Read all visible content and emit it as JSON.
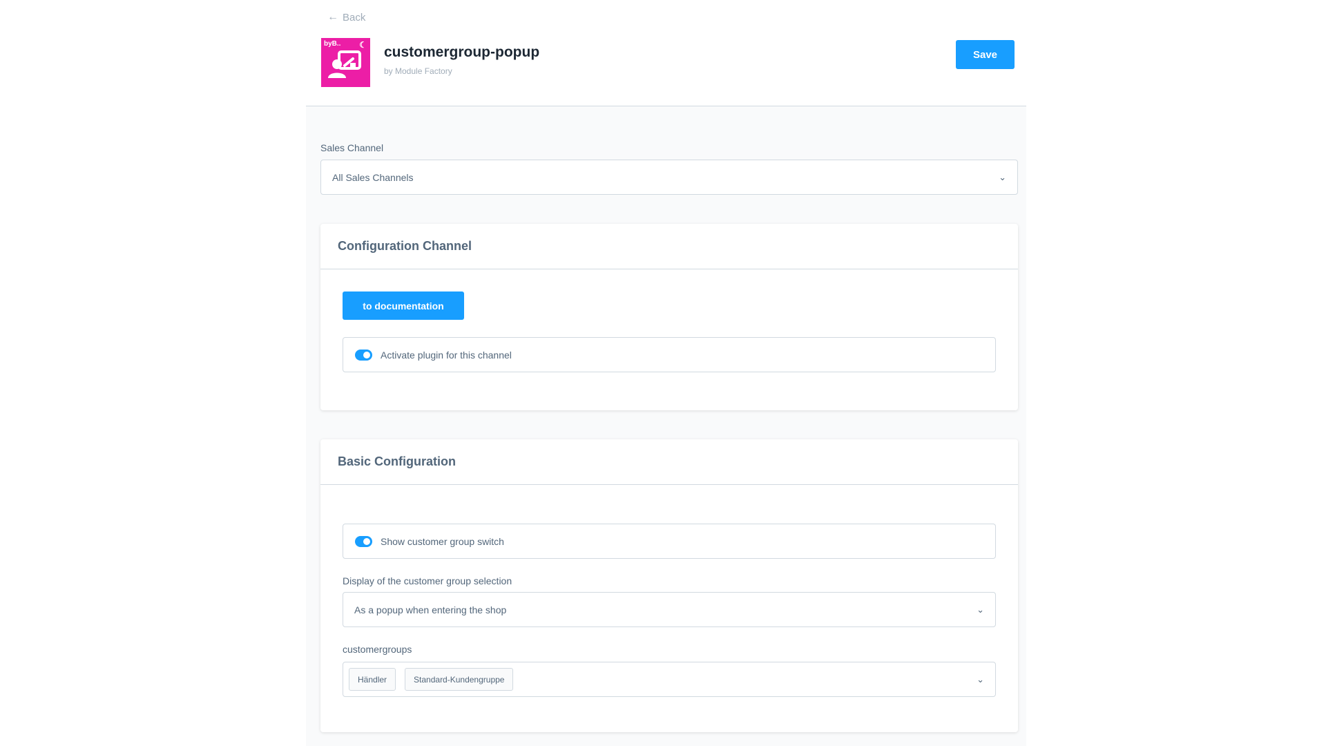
{
  "header": {
    "back_label": "Back",
    "app_icon_text": "byB..",
    "app_title": "customergroup-popup",
    "app_vendor": "by Module Factory",
    "save_label": "Save"
  },
  "sales_channel": {
    "label": "Sales Channel",
    "value": "All Sales Channels"
  },
  "configuration_channel": {
    "title": "Configuration Channel",
    "doc_button_label": "to documentation",
    "activate_label": "Activate plugin for this channel",
    "activate_enabled": true
  },
  "basic_configuration": {
    "title": "Basic Configuration",
    "show_switch_label": "Show customer group switch",
    "show_switch_enabled": true,
    "display_label": "Display of the customer group selection",
    "display_value": "As a popup when entering the shop",
    "customergroups_label": "customergroups",
    "customergroups": [
      "Händler",
      "Standard-Kundengruppe"
    ]
  },
  "icons": {
    "back": "arrow-left-icon",
    "dropdown": "chevron-down-icon",
    "app": "customer-group-popup-app-icon"
  },
  "colors": {
    "accent": "#189eff",
    "app_icon_bg": "#ec1ea6",
    "page_bg": "#f9fafb"
  }
}
